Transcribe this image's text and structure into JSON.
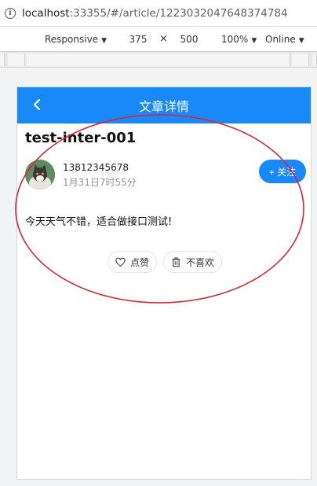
{
  "browser": {
    "url_host": "localhost",
    "url_rest": ":33355/#/article/1223032047648374784"
  },
  "device_toolbar": {
    "mode": "Responsive",
    "width": "375",
    "times": "×",
    "height": "500",
    "zoom": "100%",
    "network": "Online"
  },
  "header": {
    "title": "文章详情"
  },
  "article": {
    "title": "test-inter-001",
    "author_name": "13812345678",
    "pub_time": "1月31日7时55分",
    "follow_label": "+ 关注",
    "content": "今天天气不错，适合做接口测试!"
  },
  "actions": {
    "like_label": "点赞",
    "dislike_label": "不喜欢"
  },
  "colors": {
    "accent": "#1989fa",
    "annotation": "#d9232f"
  }
}
